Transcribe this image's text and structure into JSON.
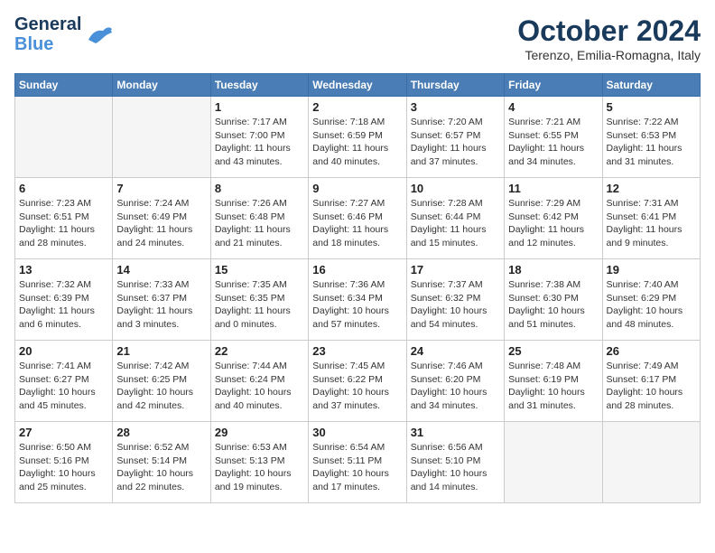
{
  "header": {
    "logo_line1": "General",
    "logo_line2": "Blue",
    "month_title": "October 2024",
    "subtitle": "Terenzo, Emilia-Romagna, Italy"
  },
  "weekdays": [
    "Sunday",
    "Monday",
    "Tuesday",
    "Wednesday",
    "Thursday",
    "Friday",
    "Saturday"
  ],
  "weeks": [
    [
      {
        "day": "",
        "info": ""
      },
      {
        "day": "",
        "info": ""
      },
      {
        "day": "1",
        "info": "Sunrise: 7:17 AM\nSunset: 7:00 PM\nDaylight: 11 hours and 43 minutes."
      },
      {
        "day": "2",
        "info": "Sunrise: 7:18 AM\nSunset: 6:59 PM\nDaylight: 11 hours and 40 minutes."
      },
      {
        "day": "3",
        "info": "Sunrise: 7:20 AM\nSunset: 6:57 PM\nDaylight: 11 hours and 37 minutes."
      },
      {
        "day": "4",
        "info": "Sunrise: 7:21 AM\nSunset: 6:55 PM\nDaylight: 11 hours and 34 minutes."
      },
      {
        "day": "5",
        "info": "Sunrise: 7:22 AM\nSunset: 6:53 PM\nDaylight: 11 hours and 31 minutes."
      }
    ],
    [
      {
        "day": "6",
        "info": "Sunrise: 7:23 AM\nSunset: 6:51 PM\nDaylight: 11 hours and 28 minutes."
      },
      {
        "day": "7",
        "info": "Sunrise: 7:24 AM\nSunset: 6:49 PM\nDaylight: 11 hours and 24 minutes."
      },
      {
        "day": "8",
        "info": "Sunrise: 7:26 AM\nSunset: 6:48 PM\nDaylight: 11 hours and 21 minutes."
      },
      {
        "day": "9",
        "info": "Sunrise: 7:27 AM\nSunset: 6:46 PM\nDaylight: 11 hours and 18 minutes."
      },
      {
        "day": "10",
        "info": "Sunrise: 7:28 AM\nSunset: 6:44 PM\nDaylight: 11 hours and 15 minutes."
      },
      {
        "day": "11",
        "info": "Sunrise: 7:29 AM\nSunset: 6:42 PM\nDaylight: 11 hours and 12 minutes."
      },
      {
        "day": "12",
        "info": "Sunrise: 7:31 AM\nSunset: 6:41 PM\nDaylight: 11 hours and 9 minutes."
      }
    ],
    [
      {
        "day": "13",
        "info": "Sunrise: 7:32 AM\nSunset: 6:39 PM\nDaylight: 11 hours and 6 minutes."
      },
      {
        "day": "14",
        "info": "Sunrise: 7:33 AM\nSunset: 6:37 PM\nDaylight: 11 hours and 3 minutes."
      },
      {
        "day": "15",
        "info": "Sunrise: 7:35 AM\nSunset: 6:35 PM\nDaylight: 11 hours and 0 minutes."
      },
      {
        "day": "16",
        "info": "Sunrise: 7:36 AM\nSunset: 6:34 PM\nDaylight: 10 hours and 57 minutes."
      },
      {
        "day": "17",
        "info": "Sunrise: 7:37 AM\nSunset: 6:32 PM\nDaylight: 10 hours and 54 minutes."
      },
      {
        "day": "18",
        "info": "Sunrise: 7:38 AM\nSunset: 6:30 PM\nDaylight: 10 hours and 51 minutes."
      },
      {
        "day": "19",
        "info": "Sunrise: 7:40 AM\nSunset: 6:29 PM\nDaylight: 10 hours and 48 minutes."
      }
    ],
    [
      {
        "day": "20",
        "info": "Sunrise: 7:41 AM\nSunset: 6:27 PM\nDaylight: 10 hours and 45 minutes."
      },
      {
        "day": "21",
        "info": "Sunrise: 7:42 AM\nSunset: 6:25 PM\nDaylight: 10 hours and 42 minutes."
      },
      {
        "day": "22",
        "info": "Sunrise: 7:44 AM\nSunset: 6:24 PM\nDaylight: 10 hours and 40 minutes."
      },
      {
        "day": "23",
        "info": "Sunrise: 7:45 AM\nSunset: 6:22 PM\nDaylight: 10 hours and 37 minutes."
      },
      {
        "day": "24",
        "info": "Sunrise: 7:46 AM\nSunset: 6:20 PM\nDaylight: 10 hours and 34 minutes."
      },
      {
        "day": "25",
        "info": "Sunrise: 7:48 AM\nSunset: 6:19 PM\nDaylight: 10 hours and 31 minutes."
      },
      {
        "day": "26",
        "info": "Sunrise: 7:49 AM\nSunset: 6:17 PM\nDaylight: 10 hours and 28 minutes."
      }
    ],
    [
      {
        "day": "27",
        "info": "Sunrise: 6:50 AM\nSunset: 5:16 PM\nDaylight: 10 hours and 25 minutes."
      },
      {
        "day": "28",
        "info": "Sunrise: 6:52 AM\nSunset: 5:14 PM\nDaylight: 10 hours and 22 minutes."
      },
      {
        "day": "29",
        "info": "Sunrise: 6:53 AM\nSunset: 5:13 PM\nDaylight: 10 hours and 19 minutes."
      },
      {
        "day": "30",
        "info": "Sunrise: 6:54 AM\nSunset: 5:11 PM\nDaylight: 10 hours and 17 minutes."
      },
      {
        "day": "31",
        "info": "Sunrise: 6:56 AM\nSunset: 5:10 PM\nDaylight: 10 hours and 14 minutes."
      },
      {
        "day": "",
        "info": ""
      },
      {
        "day": "",
        "info": ""
      }
    ]
  ]
}
